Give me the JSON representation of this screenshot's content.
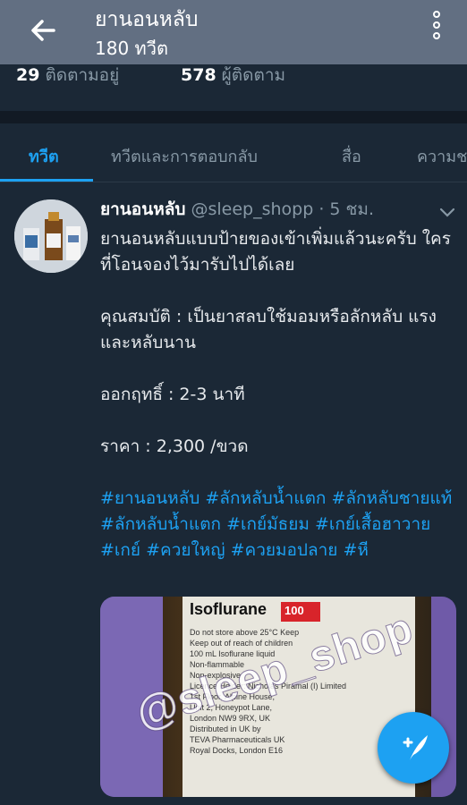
{
  "header": {
    "title": "ยานอนหลับ",
    "tweet_count": "180 ทวีต",
    "back_icon": "arrow-left-icon",
    "more_icon": "more-vertical-icon"
  },
  "stats": {
    "following_count": "29",
    "following_label": "ติดตามอยู่",
    "followers_count": "578",
    "followers_label": "ผู้ติดตาม"
  },
  "tabs": [
    {
      "label": "ทวีต",
      "active": true
    },
    {
      "label": "ทวีตและการตอบกลับ",
      "active": false
    },
    {
      "label": "สื่อ",
      "active": false
    },
    {
      "label": "ความชอบ",
      "active": false
    }
  ],
  "tweet": {
    "name": "ยานอนหลับ",
    "handle": "@sleep_shopp",
    "time": "· 5 ชม.",
    "lines": [
      "ยานอนหลับแบบป้ายของเข้าเพิ่มแล้วนะครับ ใครที่โอนจองไว้มารับไปได้เลย",
      "คุณสมบัติ : เป็นยาสลบใช้มอมหรือลักหลับ แรงและหลับนาน",
      "ออกฤทธิ์ : 2-3 นาที",
      "ราคา : 2,300 /ขวด"
    ],
    "hashtags": [
      "#ยานอนหลับ",
      "#ลักหลับน้ำแตก",
      "#ลักหลับชายแท้",
      "#ลักหลับน้ำแตก",
      "#เกย์มัธยม",
      "#เกย์เสื้อฮาวาย",
      "#เกย์",
      "#ควยใหญ่",
      "#ควยมอปลาย",
      "#หี"
    ],
    "media": {
      "product_name": "Isoflurane",
      "badge": "100",
      "watermark": "@sleep_shop",
      "label_text": "Do not store above 25°C Keep\nKeep out of reach of children\n100 mL Isoflurane liquid\nNon-flammable\nNon-explosive\nLicence Holder: Nicholas Piramal (I) Limited\n1st Floor, Alpine House,\nUnit 2, Honeypot Lane,\nLondon NW9 9RX, UK\nDistributed in UK by\nTEVA Pharmaceuticals UK\nRoyal Docks, London E16"
    }
  },
  "fab": {
    "icon": "compose-tweet-icon"
  },
  "colors": {
    "accent": "#1da1f2",
    "background": "#1b2836",
    "header": "#626f82"
  }
}
